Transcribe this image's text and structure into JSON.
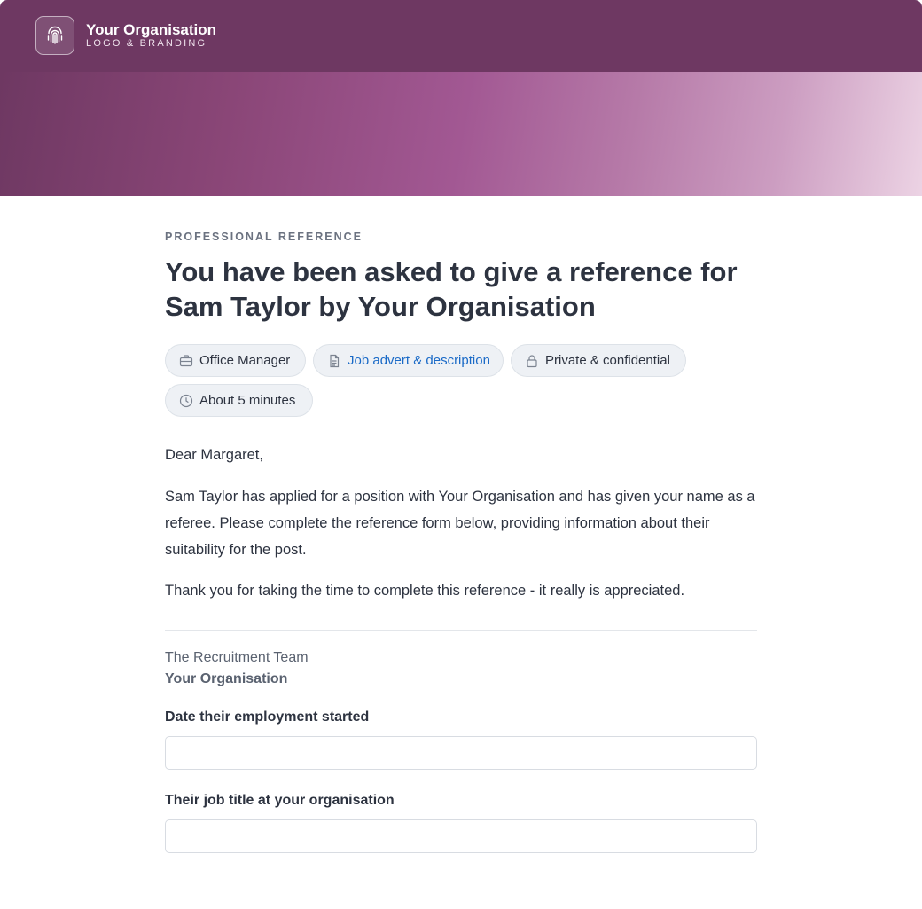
{
  "header": {
    "org_name": "Your Organisation",
    "org_subtitle": "LOGO & BRANDING",
    "logo_icon": "fingerprint-icon"
  },
  "intro": {
    "eyebrow": "PROFESSIONAL REFERENCE",
    "headline": "You have been asked to give a reference for Sam Taylor by Your Organisation"
  },
  "chips": {
    "role": {
      "label": "Office Manager",
      "icon": "briefcase-icon"
    },
    "job_advert": {
      "label": "Job advert & description",
      "icon": "document-icon"
    },
    "privacy": {
      "label": "Private & confidential",
      "icon": "lock-icon"
    },
    "duration": {
      "label": "About 5 minutes",
      "icon": "clock-icon"
    }
  },
  "letter": {
    "greeting": "Dear Margaret,",
    "body": "Sam Taylor has applied for a position with Your Organisation and has given your name as a referee. Please complete the reference form below, providing information about their suitability for the post.",
    "thanks": "Thank you for taking the time to complete this reference - it really is appreciated.",
    "sign_team": "The Recruitment Team",
    "sign_org": "Your Organisation"
  },
  "form": {
    "start_date": {
      "label": "Date their employment started",
      "value": "",
      "placeholder": ""
    },
    "job_title": {
      "label": "Their job title at your organisation",
      "value": "",
      "placeholder": ""
    }
  },
  "colors": {
    "brand": "#6e3862",
    "link": "#1a6ac7",
    "text": "#2d3340"
  }
}
